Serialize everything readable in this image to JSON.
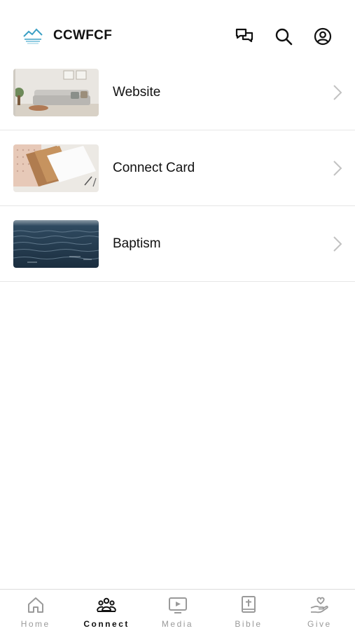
{
  "header": {
    "app_title": "CCWFCF",
    "icons": [
      "logo-icon",
      "chat-icon",
      "search-icon",
      "profile-icon"
    ]
  },
  "list": {
    "items": [
      {
        "label": "Website",
        "thumbnail": "living-room-photo"
      },
      {
        "label": "Connect Card",
        "thumbnail": "cards-photo"
      },
      {
        "label": "Baptism",
        "thumbnail": "water-photo"
      }
    ]
  },
  "tabbar": {
    "tabs": [
      {
        "label": "Home",
        "icon": "home-icon",
        "active": false
      },
      {
        "label": "Connect",
        "icon": "people-icon",
        "active": true
      },
      {
        "label": "Media",
        "icon": "tv-play-icon",
        "active": false
      },
      {
        "label": "Bible",
        "icon": "bible-icon",
        "active": false
      },
      {
        "label": "Give",
        "icon": "heart-hand-icon",
        "active": false
      }
    ]
  },
  "colors": {
    "active": "#111111",
    "inactive": "#9a9a9a",
    "divider": "#e6e6e6"
  }
}
